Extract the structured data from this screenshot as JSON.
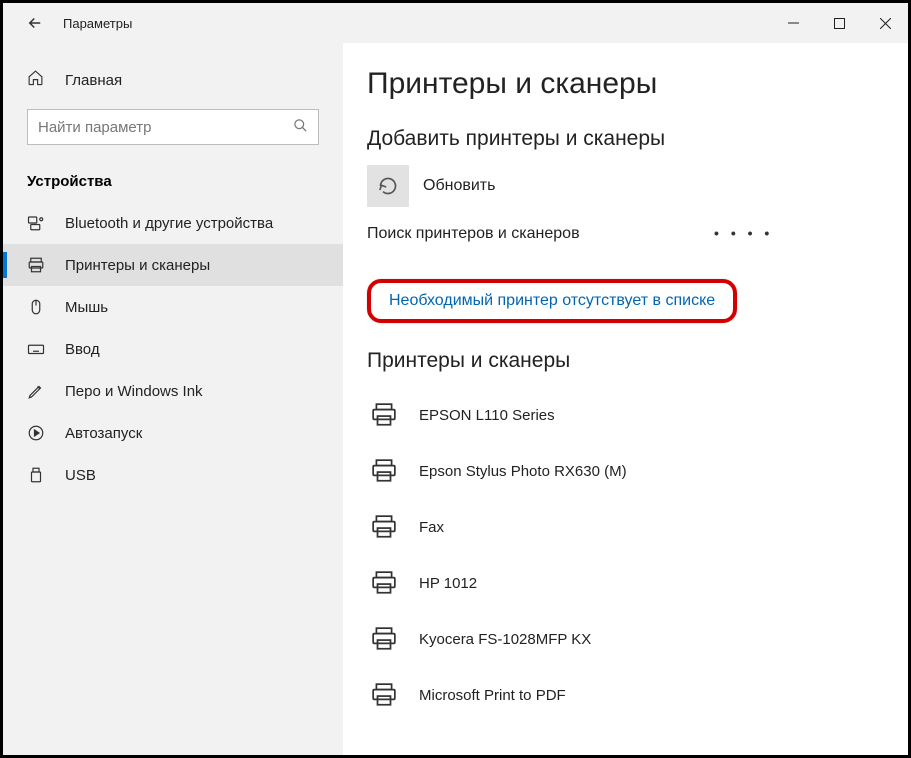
{
  "window": {
    "title": "Параметры"
  },
  "sidebar": {
    "home": "Главная",
    "search_placeholder": "Найти параметр",
    "category": "Устройства",
    "items": [
      {
        "label": "Bluetooth и другие устройства"
      },
      {
        "label": "Принтеры и сканеры"
      },
      {
        "label": "Мышь"
      },
      {
        "label": "Ввод"
      },
      {
        "label": "Перо и Windows Ink"
      },
      {
        "label": "Автозапуск"
      },
      {
        "label": "USB"
      }
    ]
  },
  "content": {
    "page_title": "Принтеры и сканеры",
    "add_section": "Добавить принтеры и сканеры",
    "refresh_label": "Обновить",
    "status": "Поиск принтеров и сканеров",
    "missing_link": "Необходимый принтер отсутствует в списке",
    "list_section": "Принтеры и сканеры",
    "printers": [
      {
        "name": "EPSON L110 Series"
      },
      {
        "name": "Epson Stylus Photo RX630 (M)"
      },
      {
        "name": "Fax"
      },
      {
        "name": "HP 1012"
      },
      {
        "name": "Kyocera FS-1028MFP KX"
      },
      {
        "name": "Microsoft Print to PDF"
      }
    ]
  }
}
